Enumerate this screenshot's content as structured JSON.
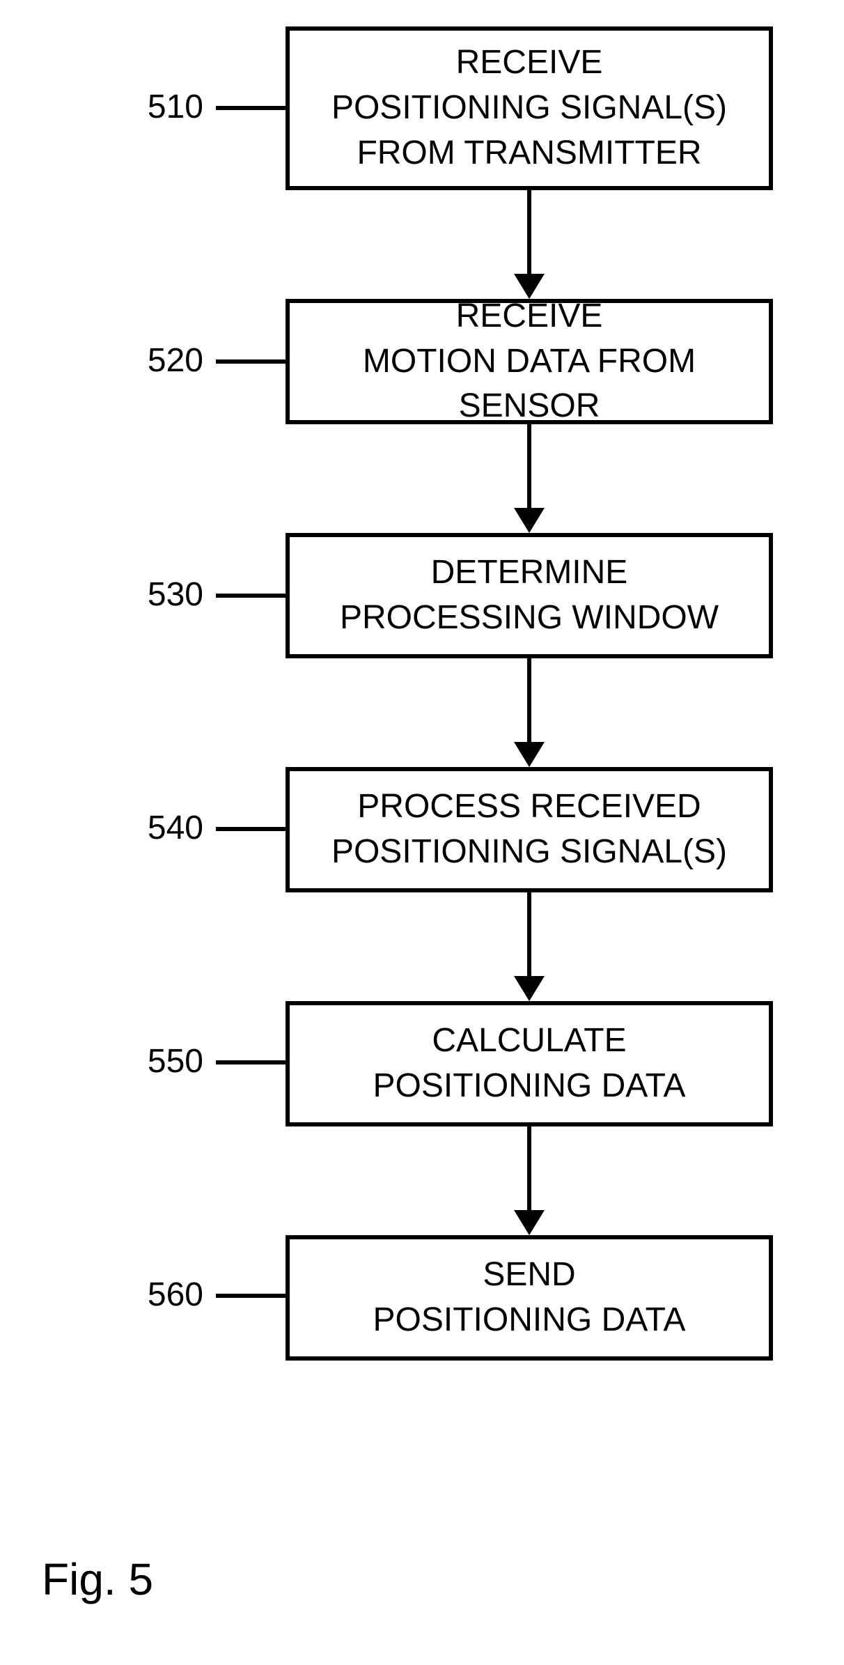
{
  "figure_label": "Fig. 5",
  "steps": [
    {
      "num": "510",
      "text": "RECEIVE\nPOSITIONING SIGNAL(S)\nFROM TRANSMITTER"
    },
    {
      "num": "520",
      "text": "RECEIVE\nMOTION DATA FROM SENSOR"
    },
    {
      "num": "530",
      "text": "DETERMINE\nPROCESSING WINDOW"
    },
    {
      "num": "540",
      "text": "PROCESS RECEIVED\nPOSITIONING SIGNAL(S)"
    },
    {
      "num": "550",
      "text": "CALCULATE\nPOSITIONING DATA"
    },
    {
      "num": "560",
      "text": "SEND\nPOSITIONING DATA"
    }
  ]
}
